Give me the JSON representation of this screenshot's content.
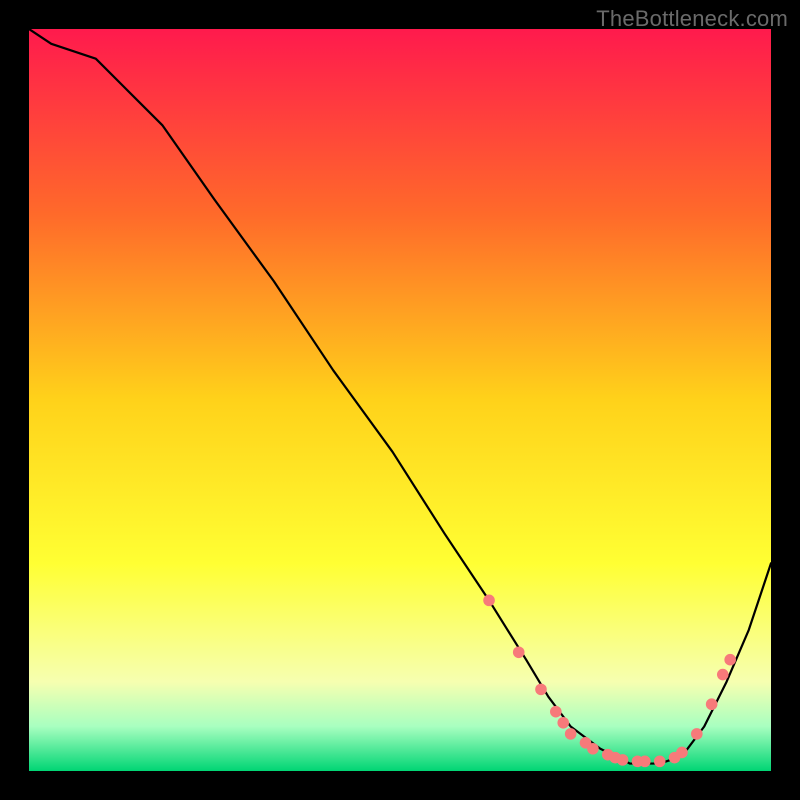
{
  "watermark": "TheBottleneck.com",
  "chart_data": {
    "type": "line",
    "title": "",
    "xlabel": "",
    "ylabel": "",
    "xlim": [
      0,
      100
    ],
    "ylim": [
      0,
      100
    ],
    "grid": false,
    "legend": false,
    "background_gradient_stops": [
      {
        "offset": 0.0,
        "color": "#ff1a4d"
      },
      {
        "offset": 0.25,
        "color": "#ff6a2a"
      },
      {
        "offset": 0.5,
        "color": "#ffd21a"
      },
      {
        "offset": 0.72,
        "color": "#ffff33"
      },
      {
        "offset": 0.88,
        "color": "#f6ffb0"
      },
      {
        "offset": 0.94,
        "color": "#a8ffc0"
      },
      {
        "offset": 1.0,
        "color": "#00d574"
      }
    ],
    "series": [
      {
        "name": "curve",
        "stroke": "#000000",
        "stroke_width": 2.2,
        "x": [
          0,
          3,
          9,
          13,
          18,
          25,
          33,
          41,
          49,
          56,
          62,
          67,
          70,
          73,
          77,
          81,
          85,
          88,
          91,
          94,
          97,
          100
        ],
        "y": [
          100,
          98,
          96,
          92,
          87,
          77,
          66,
          54,
          43,
          32,
          23,
          15,
          10,
          6,
          3,
          1,
          1,
          2,
          6,
          12,
          19,
          28
        ]
      }
    ],
    "markers": {
      "color": "#f77a7a",
      "radius": 5.8,
      "points": [
        {
          "x": 62,
          "y": 23
        },
        {
          "x": 66,
          "y": 16
        },
        {
          "x": 69,
          "y": 11
        },
        {
          "x": 71,
          "y": 8
        },
        {
          "x": 72,
          "y": 6.5
        },
        {
          "x": 73,
          "y": 5
        },
        {
          "x": 75,
          "y": 3.8
        },
        {
          "x": 76,
          "y": 3
        },
        {
          "x": 78,
          "y": 2.2
        },
        {
          "x": 79,
          "y": 1.8
        },
        {
          "x": 80,
          "y": 1.5
        },
        {
          "x": 82,
          "y": 1.3
        },
        {
          "x": 83,
          "y": 1.3
        },
        {
          "x": 85,
          "y": 1.3
        },
        {
          "x": 87,
          "y": 1.8
        },
        {
          "x": 88,
          "y": 2.5
        },
        {
          "x": 90,
          "y": 5
        },
        {
          "x": 92,
          "y": 9
        },
        {
          "x": 93.5,
          "y": 13
        },
        {
          "x": 94.5,
          "y": 15
        }
      ]
    }
  }
}
